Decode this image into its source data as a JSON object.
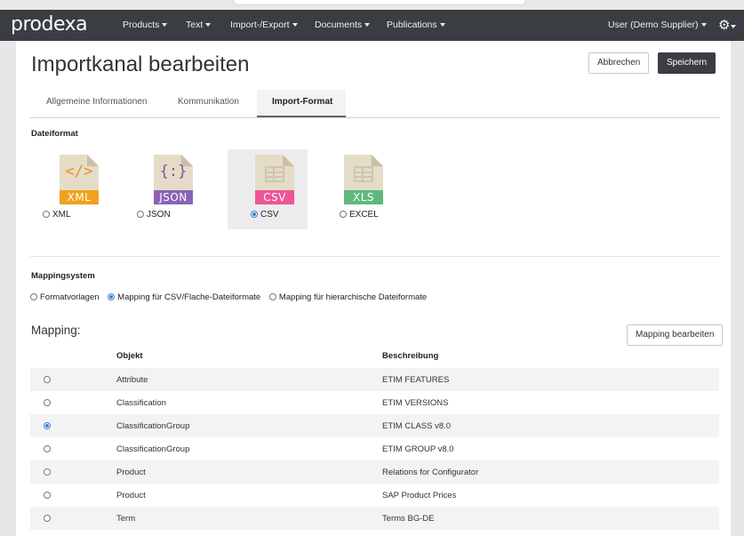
{
  "navbar": {
    "logo": "prodexa",
    "menu": [
      {
        "label": "Products"
      },
      {
        "label": "Text"
      },
      {
        "label": "Import-/Export"
      },
      {
        "label": "Documents"
      },
      {
        "label": "Publications"
      }
    ],
    "user": "User (Demo Supplier)",
    "settings_icon": "gear-icon"
  },
  "header": {
    "title": "Importkanal bearbeiten",
    "cancel_label": "Abbrechen",
    "save_label": "Speichern"
  },
  "tabs": [
    {
      "label": "Allgemeine Informationen",
      "active": false
    },
    {
      "label": "Kommunikation",
      "active": false
    },
    {
      "label": "Import-Format",
      "active": true
    }
  ],
  "dateiformat": {
    "label": "Dateiformat",
    "formats": [
      {
        "badge": "XML",
        "glyph": "</>",
        "radio_label": "XML",
        "color": "#f0a21f",
        "glyph_color": "#e8931a",
        "selected": false
      },
      {
        "badge": "JSON",
        "glyph": "{:}",
        "radio_label": "JSON",
        "color": "#8a63b7",
        "glyph_color": "#7b57a8",
        "selected": false
      },
      {
        "badge": "CSV",
        "glyph": "",
        "radio_label": "CSV",
        "color": "#ee5596",
        "glyph_color": "#cfc6b1",
        "selected": true
      },
      {
        "badge": "XLS",
        "glyph": "",
        "radio_label": "EXCEL",
        "color": "#5fb97b",
        "glyph_color": "#cfc6b1",
        "selected": false
      }
    ]
  },
  "mappingsystem": {
    "label": "Mappingsystem",
    "options": [
      {
        "label": "Formatvorlagen",
        "selected": false
      },
      {
        "label": "Mapping für CSV/Flache-Dateiformate",
        "selected": true
      },
      {
        "label": "Mapping für hierarchische Dateiformate",
        "selected": false
      }
    ]
  },
  "mapping": {
    "heading": "Mapping:",
    "edit_label": "Mapping bearbeiten",
    "columns": [
      "Objekt",
      "Beschreibung"
    ],
    "rows": [
      {
        "objekt": "Attribute",
        "beschreibung": "ETIM FEATURES",
        "selected": false
      },
      {
        "objekt": "Classification",
        "beschreibung": "ETIM VERSIONS",
        "selected": false
      },
      {
        "objekt": "ClassificationGroup",
        "beschreibung": "ETIM CLASS v8.0",
        "selected": true
      },
      {
        "objekt": "ClassificationGroup",
        "beschreibung": "ETIM GROUP v8.0",
        "selected": false
      },
      {
        "objekt": "Product",
        "beschreibung": "Relations for Configurator",
        "selected": false
      },
      {
        "objekt": "Product",
        "beschreibung": "SAP Product Prices",
        "selected": false
      },
      {
        "objekt": "Term",
        "beschreibung": "Terms BG-DE",
        "selected": false
      }
    ]
  }
}
